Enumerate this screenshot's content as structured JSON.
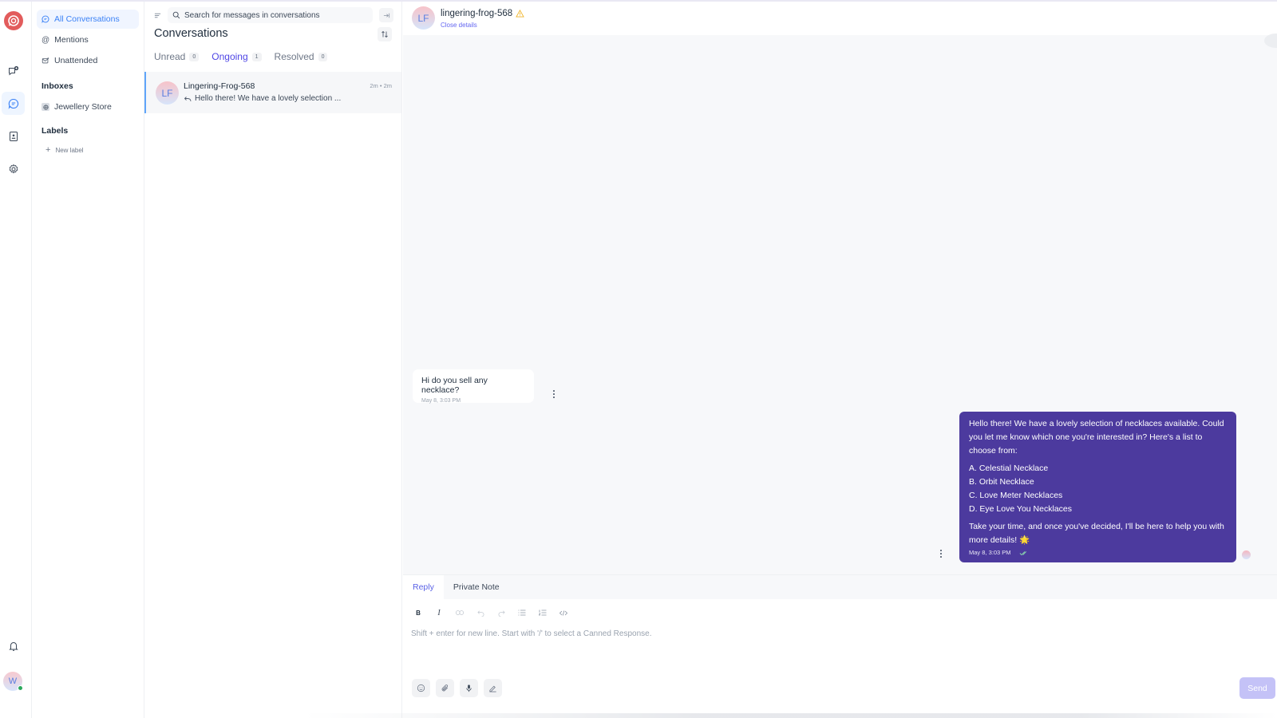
{
  "app": {
    "brand_color": "#e25c5c",
    "accent_color": "#4f46e5"
  },
  "rail": {
    "items": [
      {
        "name": "new-conversation",
        "icon": "chat-plus-icon"
      },
      {
        "name": "conversations",
        "icon": "chat-bubble-icon",
        "active": true
      },
      {
        "name": "contacts",
        "icon": "contact-book-icon"
      },
      {
        "name": "settings",
        "icon": "gear-icon"
      }
    ],
    "notifications_icon": "bell-icon",
    "user_initial": "W",
    "user_status": "online"
  },
  "sidebar": {
    "items": [
      {
        "label": "All Conversations",
        "icon": "chat-bubble-icon",
        "active": true
      },
      {
        "label": "Mentions",
        "icon": "at-icon"
      },
      {
        "label": "Unattended",
        "icon": "mail-icon"
      }
    ],
    "inboxes_title": "Inboxes",
    "inboxes": [
      {
        "label": "Jewellery Store",
        "icon": "globe-icon"
      }
    ],
    "labels_title": "Labels",
    "new_label": "New label"
  },
  "conversation_list": {
    "search_placeholder": "Search for messages in conversations",
    "title": "Conversations",
    "tabs": [
      {
        "label": "Unread",
        "count": "0"
      },
      {
        "label": "Ongoing",
        "count": "1",
        "active": true
      },
      {
        "label": "Resolved",
        "count": "0"
      }
    ],
    "items": [
      {
        "initials": "LF",
        "name": "Lingering-Frog-568",
        "time": "2m • 2m",
        "preview": "Hello there! We have a lovely selection ..."
      }
    ]
  },
  "chat": {
    "contact_initials": "LF",
    "contact_name": "lingering-frog-568",
    "warning_icon": "warning-icon",
    "close_details": "Close details",
    "messages": [
      {
        "direction": "incoming",
        "text": "Hi do you sell any necklace?",
        "time": "May 8, 3:03 PM"
      },
      {
        "direction": "outgoing",
        "intro": "Hello there! We have a lovely selection of necklaces available. Could you let me know which one you're interested in? Here's a list to choose from:",
        "options": [
          "A. Celestial Necklace",
          "B. Orbit Necklace",
          "C. Love Meter Necklaces",
          "D. Eye Love You Necklaces"
        ],
        "outro": "Take your time, and once you've decided, I'll be here to help you with more details! 🌟",
        "time": "May 8, 3:03 PM",
        "status": "read",
        "bubble_color": "#4c3a9e"
      }
    ]
  },
  "reply": {
    "tabs": [
      {
        "label": "Reply",
        "active": true
      },
      {
        "label": "Private Note"
      }
    ],
    "toolbar": [
      "bold",
      "italic",
      "link",
      "undo",
      "redo",
      "bullet-list",
      "numbered-list",
      "code"
    ],
    "placeholder": "Shift + enter for new line. Start with '/' to select a Canned Response.",
    "actions": [
      "emoji",
      "attachment",
      "microphone",
      "signature"
    ],
    "send_label": "Send"
  }
}
